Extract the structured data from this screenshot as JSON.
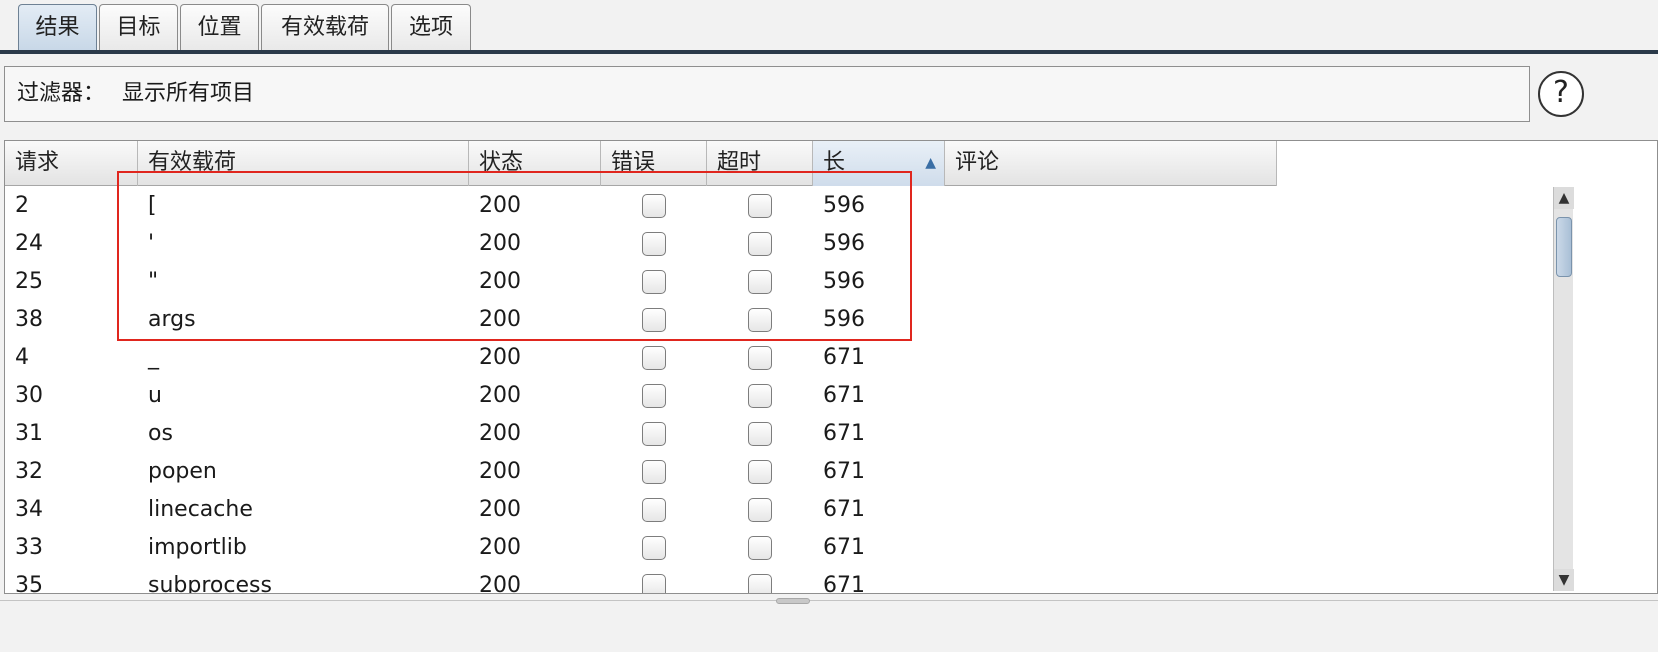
{
  "tabs": [
    {
      "label": "结果",
      "active": true
    },
    {
      "label": "目标",
      "active": false
    },
    {
      "label": "位置",
      "active": false
    },
    {
      "label": "有效载荷",
      "active": false
    },
    {
      "label": "选项",
      "active": false
    }
  ],
  "filter": {
    "label": "过滤器：",
    "value": "显示所有项目"
  },
  "help_icon": "?",
  "table": {
    "columns": [
      "请求",
      "有效载荷",
      "状态",
      "错误",
      "超时",
      "长",
      "评论"
    ],
    "sorted_column": "长",
    "sort_direction": "ascending",
    "sort_indicator": "▲",
    "rows": [
      {
        "request": "2",
        "payload": "[",
        "status": "200",
        "error": false,
        "timeout": false,
        "length": "596",
        "comment": ""
      },
      {
        "request": "24",
        "payload": "'",
        "status": "200",
        "error": false,
        "timeout": false,
        "length": "596",
        "comment": ""
      },
      {
        "request": "25",
        "payload": "\"",
        "status": "200",
        "error": false,
        "timeout": false,
        "length": "596",
        "comment": ""
      },
      {
        "request": "38",
        "payload": "args",
        "status": "200",
        "error": false,
        "timeout": false,
        "length": "596",
        "comment": ""
      },
      {
        "request": "4",
        "payload": "_",
        "status": "200",
        "error": false,
        "timeout": false,
        "length": "671",
        "comment": ""
      },
      {
        "request": "30",
        "payload": "u",
        "status": "200",
        "error": false,
        "timeout": false,
        "length": "671",
        "comment": ""
      },
      {
        "request": "31",
        "payload": "os",
        "status": "200",
        "error": false,
        "timeout": false,
        "length": "671",
        "comment": ""
      },
      {
        "request": "32",
        "payload": "popen",
        "status": "200",
        "error": false,
        "timeout": false,
        "length": "671",
        "comment": ""
      },
      {
        "request": "34",
        "payload": "linecache",
        "status": "200",
        "error": false,
        "timeout": false,
        "length": "671",
        "comment": ""
      },
      {
        "request": "33",
        "payload": "importlib",
        "status": "200",
        "error": false,
        "timeout": false,
        "length": "671",
        "comment": ""
      },
      {
        "request": "35",
        "payload": "subprocess",
        "status": "200",
        "error": false,
        "timeout": false,
        "length": "671",
        "comment": ""
      }
    ]
  },
  "scrollbar": {
    "up": "▲",
    "down": "▼"
  },
  "colors": {
    "highlight": "#e0261e",
    "tab_active": "#c7d7e7",
    "sort_arrow": "#3a6ea5"
  }
}
